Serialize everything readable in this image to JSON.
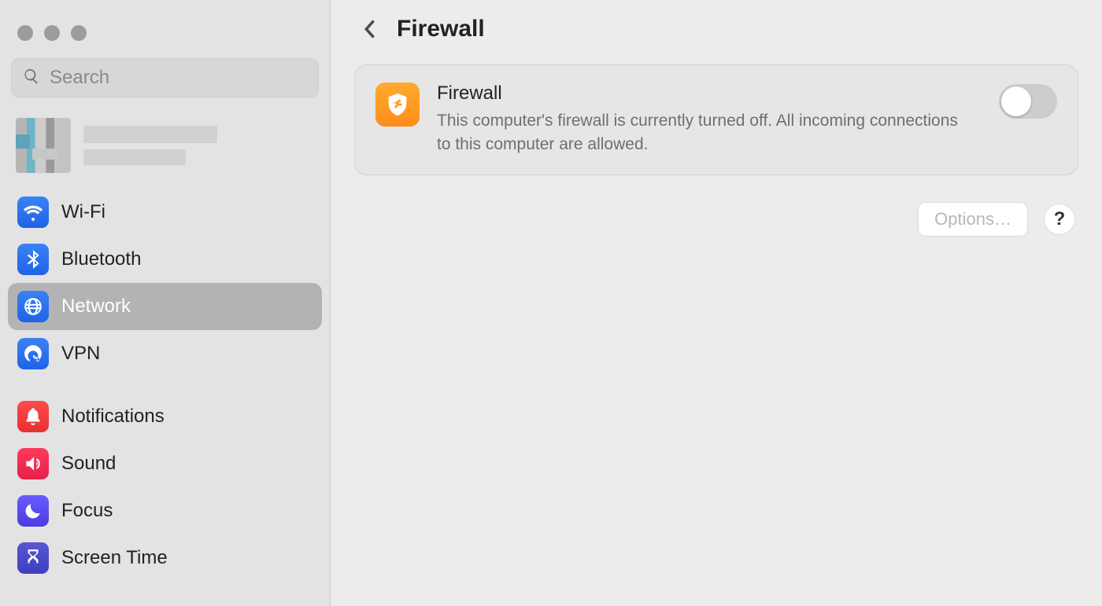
{
  "window": {
    "title": "Firewall"
  },
  "search": {
    "placeholder": "Search",
    "value": ""
  },
  "sidebar": {
    "groups": [
      {
        "items": [
          {
            "id": "wifi",
            "label": "Wi-Fi",
            "icon": "wifi-icon",
            "color": "blue",
            "selected": false
          },
          {
            "id": "bluetooth",
            "label": "Bluetooth",
            "icon": "bluetooth-icon",
            "color": "blue",
            "selected": false
          },
          {
            "id": "network",
            "label": "Network",
            "icon": "globe-icon",
            "color": "blue",
            "selected": true
          },
          {
            "id": "vpn",
            "label": "VPN",
            "icon": "vpn-icon",
            "color": "blue",
            "selected": false
          }
        ]
      },
      {
        "items": [
          {
            "id": "notifications",
            "label": "Notifications",
            "icon": "bell-icon",
            "color": "red",
            "selected": false
          },
          {
            "id": "sound",
            "label": "Sound",
            "icon": "speaker-icon",
            "color": "pink",
            "selected": false
          },
          {
            "id": "focus",
            "label": "Focus",
            "icon": "moon-icon",
            "color": "purple",
            "selected": false
          },
          {
            "id": "screentime",
            "label": "Screen Time",
            "icon": "hourglass-icon",
            "color": "indigo",
            "selected": false
          }
        ]
      }
    ]
  },
  "main": {
    "card": {
      "title": "Firewall",
      "description": "This computer's firewall is currently turned off. All incoming connections to this computer are allowed.",
      "toggle_on": false
    },
    "options_label": "Options…",
    "help_label": "?"
  }
}
